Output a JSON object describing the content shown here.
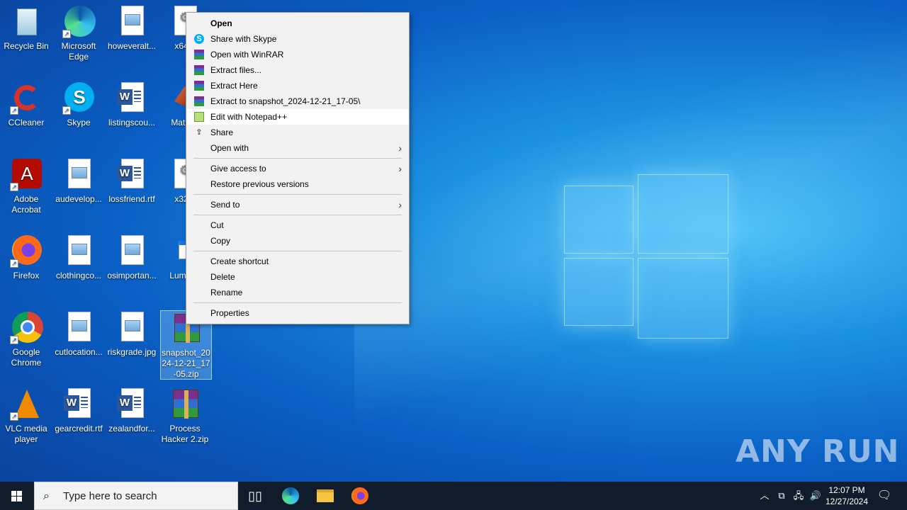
{
  "desktop": {
    "icons": [
      {
        "label": "Recycle Bin"
      },
      {
        "label": "Microsoft Edge"
      },
      {
        "label": "howeveralt..."
      },
      {
        "label": "x64..."
      },
      {
        "label": "CCleaner"
      },
      {
        "label": "Skype"
      },
      {
        "label": "listingscou..."
      },
      {
        "label": "Matla..."
      },
      {
        "label": "Adobe Acrobat"
      },
      {
        "label": "audevelop..."
      },
      {
        "label": "lossfriend.rtf"
      },
      {
        "label": "x32..."
      },
      {
        "label": "Firefox"
      },
      {
        "label": "clothingco..."
      },
      {
        "label": "osimportan..."
      },
      {
        "label": "Lumm..."
      },
      {
        "label": "Google Chrome"
      },
      {
        "label": "cutlocation..."
      },
      {
        "label": "riskgrade.jpg"
      },
      {
        "label": "snapshot_2024-12-21_17-05.zip"
      },
      {
        "label": "VLC media player"
      },
      {
        "label": "gearcredit.rtf"
      },
      {
        "label": "zealandfor..."
      },
      {
        "label": "Process Hacker 2.zip"
      }
    ]
  },
  "context_menu": {
    "items": [
      {
        "label": "Open"
      },
      {
        "label": "Share with Skype"
      },
      {
        "label": "Open with WinRAR"
      },
      {
        "label": "Extract files..."
      },
      {
        "label": "Extract Here"
      },
      {
        "label": "Extract to snapshot_2024-12-21_17-05\\"
      },
      {
        "label": "Edit with Notepad++"
      },
      {
        "label": "Share"
      },
      {
        "label": "Open with"
      },
      {
        "label": "Give access to"
      },
      {
        "label": "Restore previous versions"
      },
      {
        "label": "Send to"
      },
      {
        "label": "Cut"
      },
      {
        "label": "Copy"
      },
      {
        "label": "Create shortcut"
      },
      {
        "label": "Delete"
      },
      {
        "label": "Rename"
      },
      {
        "label": "Properties"
      }
    ],
    "hovered_item": "Edit with Notepad++"
  },
  "taskbar": {
    "search_placeholder": "Type here to search",
    "time": "12:07 PM",
    "date": "12/27/2024"
  },
  "watermark": "ANY RUN"
}
